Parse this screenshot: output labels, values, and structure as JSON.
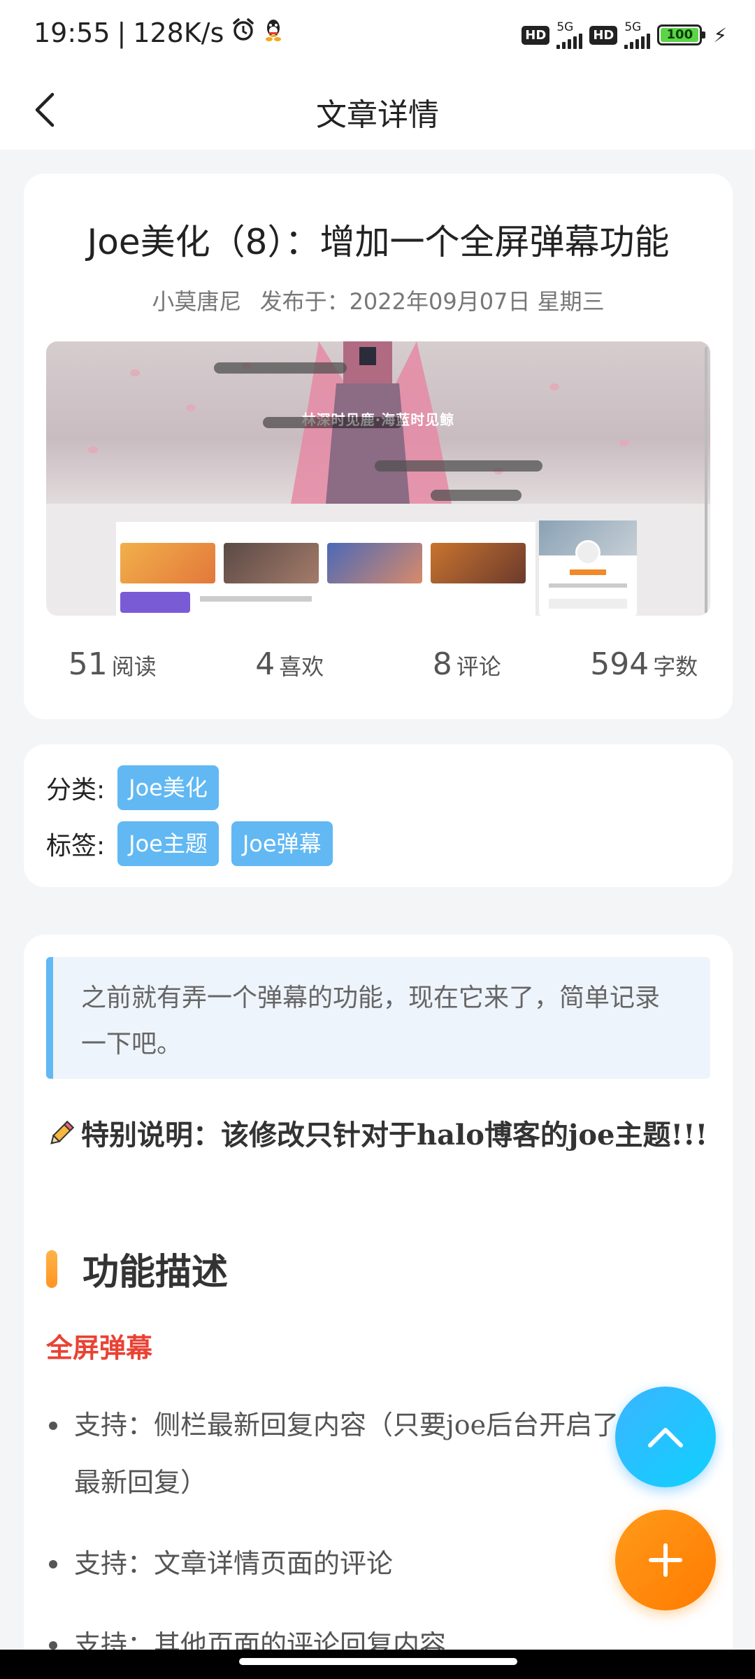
{
  "status_bar": {
    "time": "19:55",
    "speed": "128K/s",
    "network1": "5G",
    "network2": "5G",
    "hd": "HD",
    "battery": "100"
  },
  "header": {
    "title": "文章详情"
  },
  "article": {
    "title": "Joe美化（8）：增加一个全屏弹幕功能",
    "author": "小莫唐尼",
    "published": "发布于：2022年09月07日 星期三",
    "cover_hero_title": "林深时见鹿·海蓝时见鲸",
    "stats": [
      {
        "value": "51",
        "label": "阅读"
      },
      {
        "value": "4",
        "label": "喜欢"
      },
      {
        "value": "8",
        "label": "评论"
      },
      {
        "value": "594",
        "label": "字数"
      }
    ]
  },
  "taxonomy": {
    "category_label": "分类:",
    "categories": [
      "Joe美化"
    ],
    "tags_label": "标签:",
    "tags": [
      "Joe主题",
      "Joe弹幕"
    ]
  },
  "content": {
    "quote": "之前就有弄一个弹幕的功能，现在它来了，简单记录一下吧。",
    "special_note": "特别说明：该修改只针对于halo博客的joe主题!!!",
    "section_title": "功能描述",
    "subsection_title": "全屏弹幕",
    "list": [
      "支持：侧栏最新回复内容（只要joe后台开启了侧栏的最新回复）",
      "支持：文章详情页面的评论",
      "支持：其他页面的评论回复内容"
    ]
  },
  "colors": {
    "tag_bg": "#61b8f3",
    "quote_border": "#61b8f3",
    "accent_red": "#e94234",
    "fab_up": "#1ec2ff",
    "fab_add": "#ff8a0e"
  }
}
